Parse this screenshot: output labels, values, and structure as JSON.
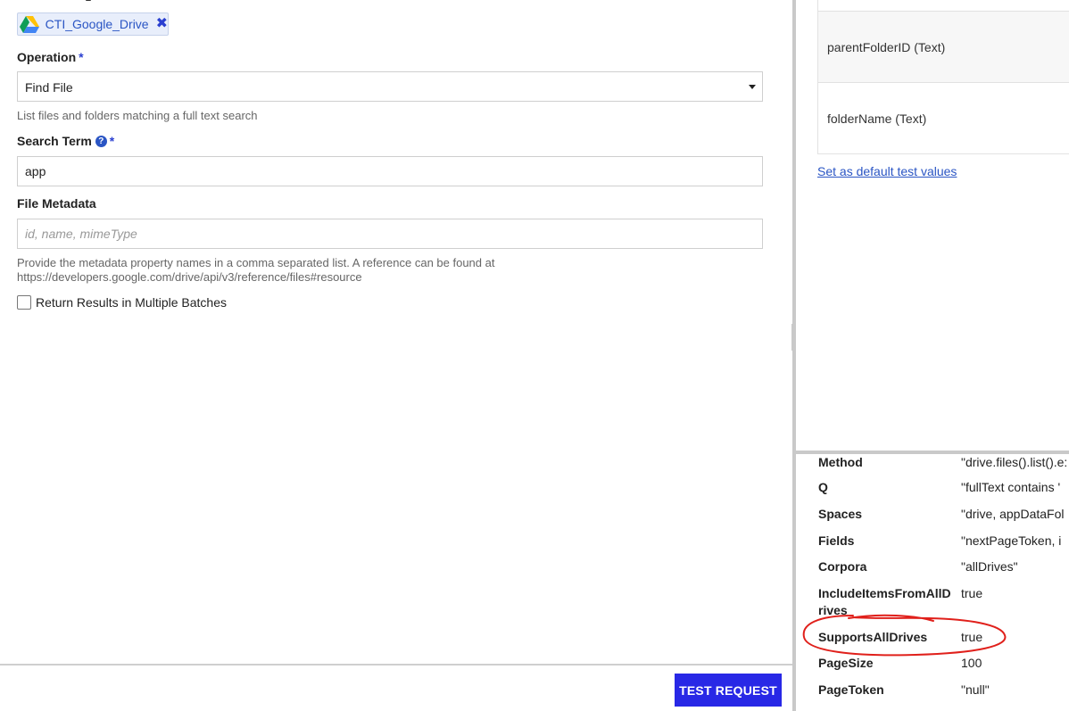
{
  "connection": {
    "name": "CTI_Google_Drive",
    "remove_glyph": "✖",
    "icon": "google-drive-icon"
  },
  "operation": {
    "label": "Operation",
    "required_mark": "*",
    "value": "Find File",
    "help": "List files and folders matching a full text search"
  },
  "search_term": {
    "label": "Search Term",
    "help_glyph": "?",
    "required_mark": "*",
    "value": "app"
  },
  "file_metadata": {
    "label": "File Metadata",
    "placeholder": "id, name, mimeType",
    "help_line1": "Provide the metadata property names in a comma separated list. A reference can be found at",
    "help_line2": "https://developers.google.com/drive/api/v3/reference/files#resource"
  },
  "batches": {
    "label": "Return Results in Multiple Batches",
    "checked": false
  },
  "actions": {
    "test_request": "TEST REQUEST"
  },
  "test_params": {
    "rows": [
      {
        "label": "parentFolderID (Text)"
      },
      {
        "label": "folderName (Text)"
      }
    ],
    "default_link": "Set as default test values"
  },
  "request_details": [
    {
      "key": "Method",
      "value": "\"drive.files().list().e:"
    },
    {
      "key": "Q",
      "value": "\"fullText contains '"
    },
    {
      "key": "Spaces",
      "value": "\"drive, appDataFol"
    },
    {
      "key": "Fields",
      "value": "\"nextPageToken, i"
    },
    {
      "key": "Corpora",
      "value": "\"allDrives\""
    },
    {
      "key": "IncludeItemsFromAllDrives",
      "value": "true"
    },
    {
      "key": "SupportsAllDrives",
      "value": "true"
    },
    {
      "key": "PageSize",
      "value": "100"
    },
    {
      "key": "PageToken",
      "value": "\"null\""
    }
  ],
  "colors": {
    "accent": "#2828e6",
    "link": "#2a55c4",
    "annotation": "#e0201b"
  }
}
